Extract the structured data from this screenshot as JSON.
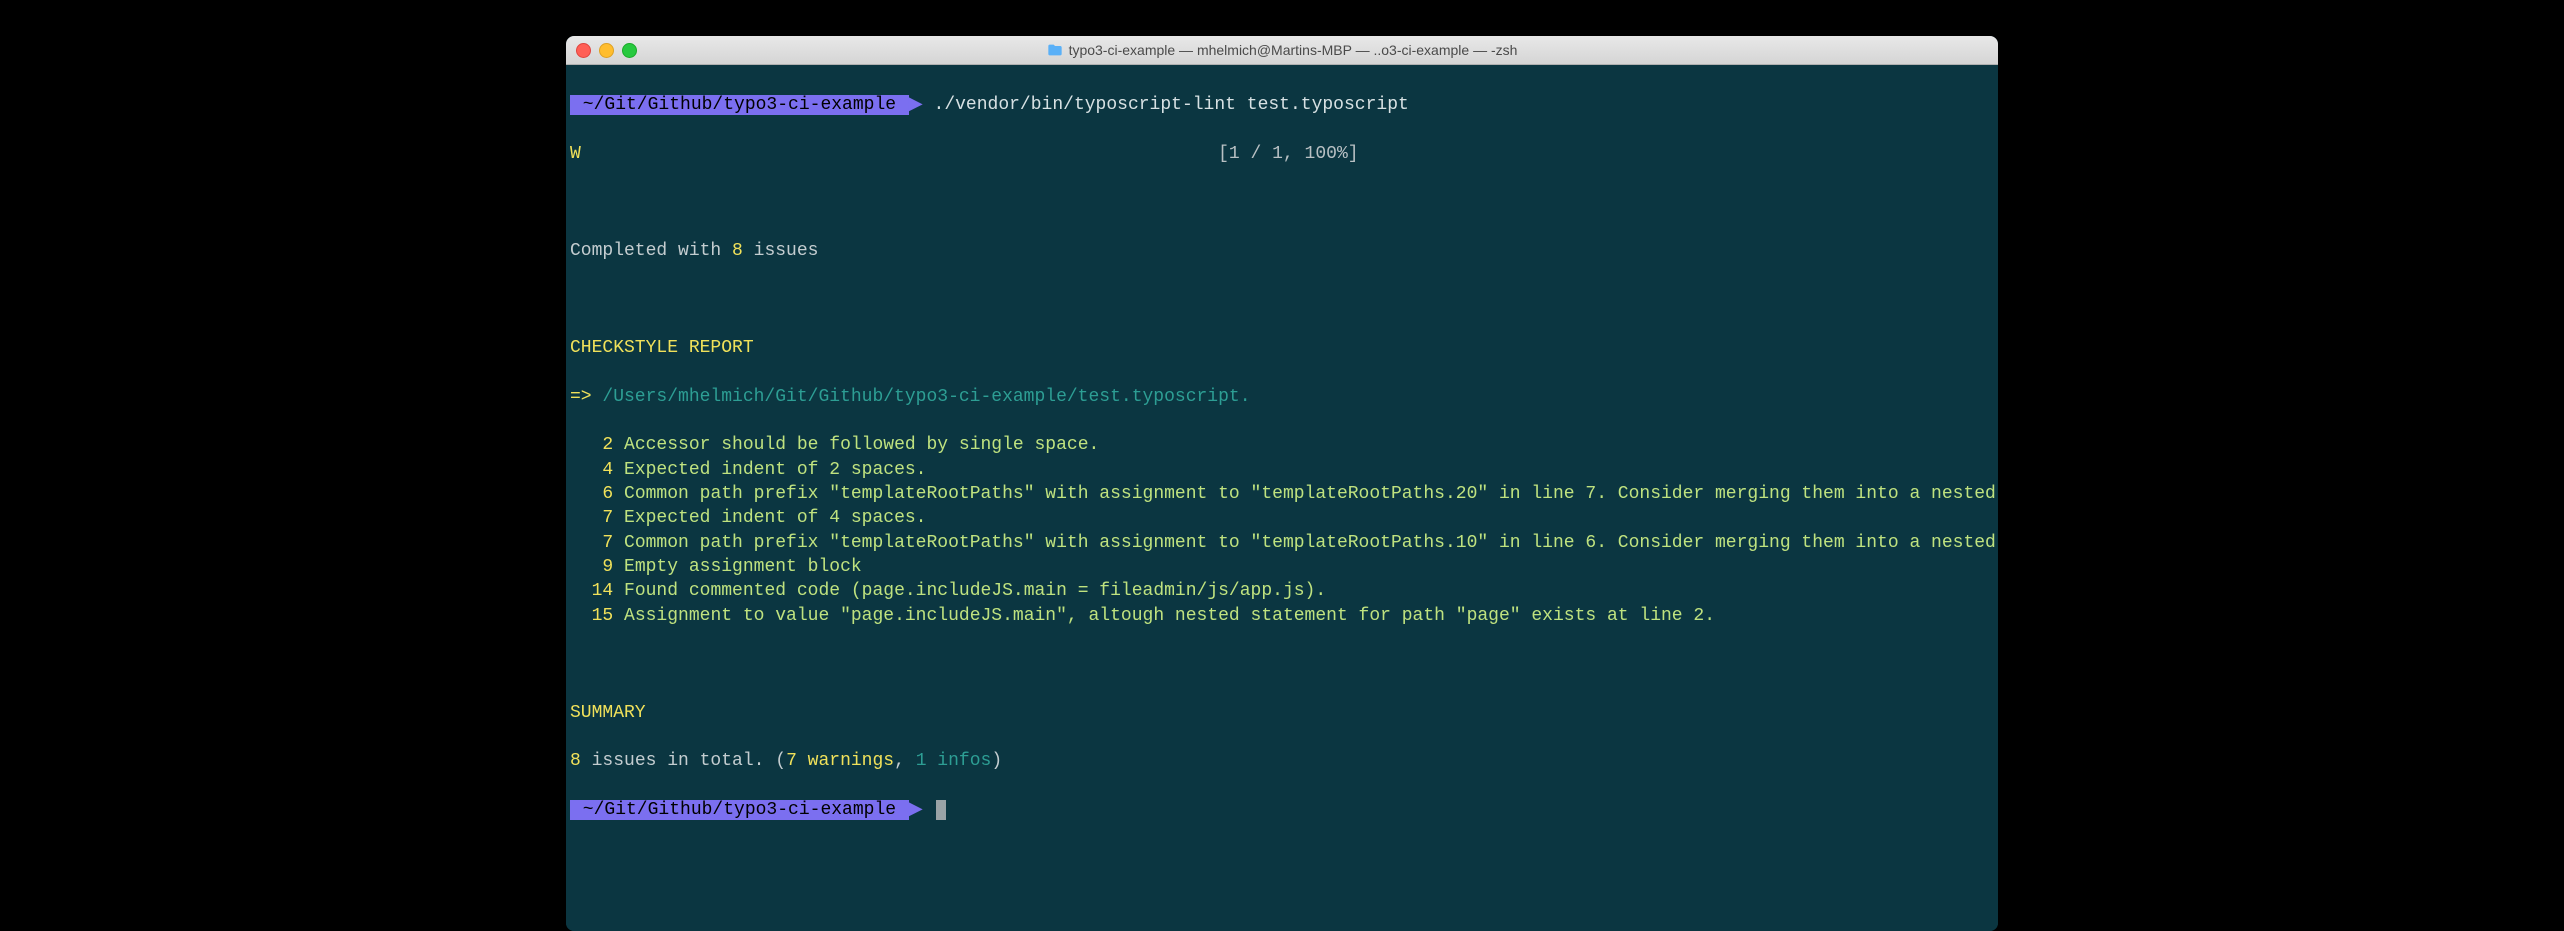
{
  "window": {
    "title": "typo3-ci-example — mhelmich@Martins-MBP — ..o3-ci-example — -zsh"
  },
  "prompt": {
    "path": " ~/Git/Github/typo3-ci-example ",
    "arrow": "▶",
    "command": "./vendor/bin/typoscript-lint test.typoscript"
  },
  "progress": {
    "w": "W",
    "status": "[1 / 1, 100%]"
  },
  "completed": {
    "prefix": "Completed with ",
    "count": "8",
    "suffix": " issues"
  },
  "checkstyle": {
    "heading": "CHECKSTYLE REPORT",
    "arrow": "=> ",
    "file": "/Users/mhelmich/Git/Github/typo3-ci-example/test.typoscript.",
    "issues": [
      {
        "line": "2",
        "msg": "Accessor should be followed by single space."
      },
      {
        "line": "4",
        "msg": "Expected indent of 2 spaces."
      },
      {
        "line": "6",
        "msg": "Common path prefix \"templateRootPaths\" with assignment to \"templateRootPaths.20\" in line 7. Consider merging them into a nested assignment."
      },
      {
        "line": "7",
        "msg": "Expected indent of 4 spaces."
      },
      {
        "line": "7",
        "msg": "Common path prefix \"templateRootPaths\" with assignment to \"templateRootPaths.10\" in line 6. Consider merging them into a nested assignment."
      },
      {
        "line": "9",
        "msg": "Empty assignment block"
      },
      {
        "line": "14",
        "msg": "Found commented code (page.includeJS.main = fileadmin/js/app.js)."
      },
      {
        "line": "15",
        "msg": "Assignment to value \"page.includeJS.main\", altough nested statement for path \"page\" exists at line 2."
      }
    ]
  },
  "summary": {
    "heading": "SUMMARY",
    "issues_num": "8",
    "issues_text": " issues in total. ",
    "paren_open": "(",
    "warnings": "7 warnings",
    "sep": ", ",
    "infos": "1 infos",
    "paren_close": ")"
  },
  "prompt2": {
    "path": " ~/Git/Github/typo3-ci-example ",
    "arrow": "▶"
  }
}
